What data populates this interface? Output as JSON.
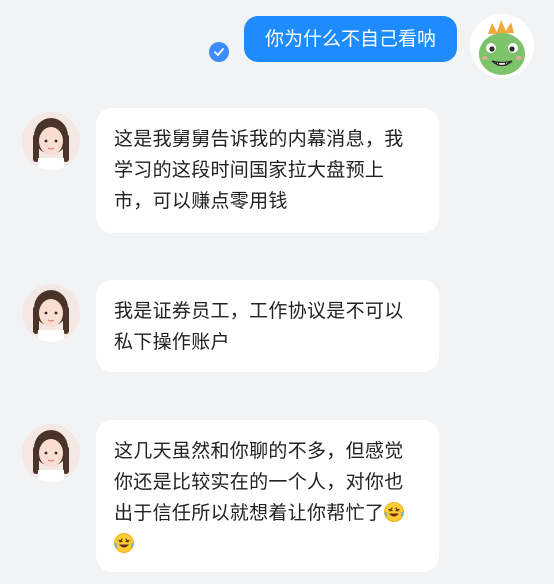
{
  "conversation": {
    "outgoing": {
      "text": "你为什么不自己看呐",
      "bubble_color": "#1e8cff",
      "status_icon": "check-circle-icon",
      "avatar_icon": "green-dinosaur-avatar"
    },
    "incoming": [
      {
        "text": "这是我舅舅告诉我的内幕消息，我学习的这段时间国家拉大盘预上市，可以赚点零用钱",
        "emojis": []
      },
      {
        "text": "我是证券员工，工作协议是不可以私下操作账户",
        "emojis": []
      },
      {
        "text": "这几天虽然和你聊的不多，但感觉你还是比较实在的一个人，对你也出于信任所以就想着让你帮忙了",
        "emojis": [
          "rofl-emoji",
          "rofl-emoji"
        ]
      }
    ],
    "incoming_avatar_icon": "girl-with-braids-avatar",
    "background_color": "#f2f3f5"
  }
}
